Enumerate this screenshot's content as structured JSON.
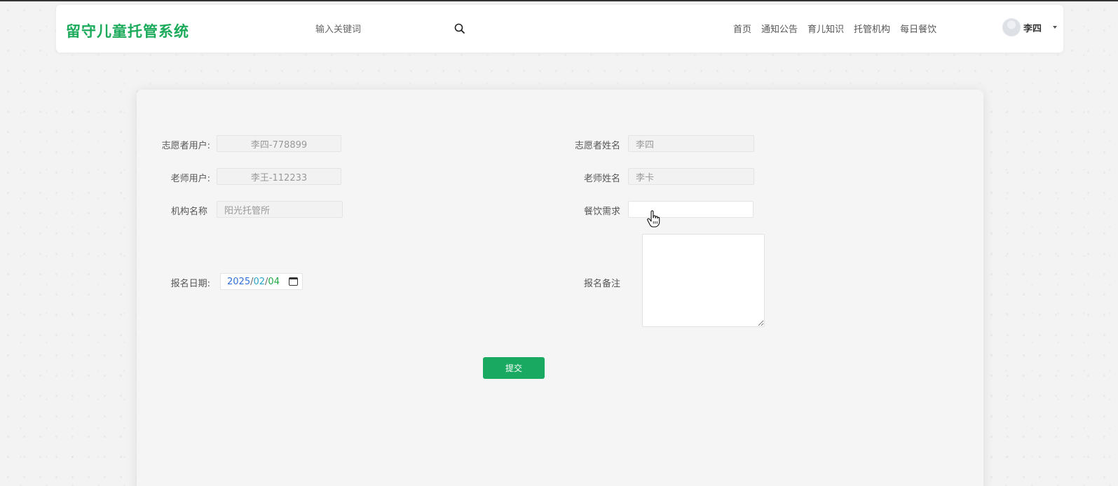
{
  "header": {
    "logo": "留守儿童托管系统",
    "search_placeholder": "输入关键词",
    "nav": [
      "首页",
      "通知公告",
      "育儿知识",
      "托管机构",
      "每日餐饮"
    ],
    "user_name": "李四"
  },
  "form": {
    "volunteer_account": {
      "label": "志愿者用户:",
      "value": "李四-778899"
    },
    "volunteer_name": {
      "label": "志愿者姓名",
      "value": "李四"
    },
    "teacher_account": {
      "label": "老师用户:",
      "value": "李王-112233"
    },
    "teacher_name": {
      "label": "老师姓名",
      "value": "李卡"
    },
    "institution_name": {
      "label": "机构名称",
      "value": "阳光托管所"
    },
    "meal_requirement": {
      "label": "餐饮需求",
      "value": ""
    },
    "signup_date": {
      "label": "报名日期:",
      "year": "2025",
      "month": "02",
      "day": "04",
      "separator": "/"
    },
    "signup_note": {
      "label": "报名备注",
      "value": ""
    },
    "submit_label": "提交"
  },
  "colors": {
    "brand": "#1aaa5a",
    "button": "#19a960"
  }
}
